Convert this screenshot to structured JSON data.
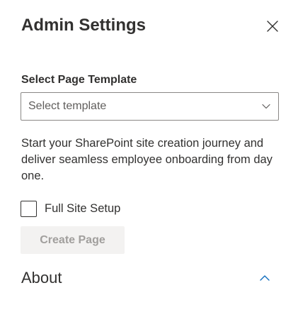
{
  "panel": {
    "title": "Admin Settings",
    "close_icon": "close-icon"
  },
  "template_select": {
    "label": "Select Page Template",
    "placeholder": "Select template",
    "chevron_icon": "chevron-down-icon"
  },
  "description": "Start your SharePoint site creation journey and deliver seamless employee onboarding from day one.",
  "full_site_setup": {
    "label": "Full Site Setup",
    "checked": false
  },
  "create_page": {
    "label": "Create Page",
    "disabled": true
  },
  "about": {
    "title": "About",
    "expanded": true,
    "chevron_icon": "chevron-up-icon"
  },
  "colors": {
    "accent": "#0f6cbd",
    "text": "#323130",
    "disabled_bg": "#f3f2f1",
    "disabled_text": "#a19f9d",
    "border": "#8a8886"
  }
}
